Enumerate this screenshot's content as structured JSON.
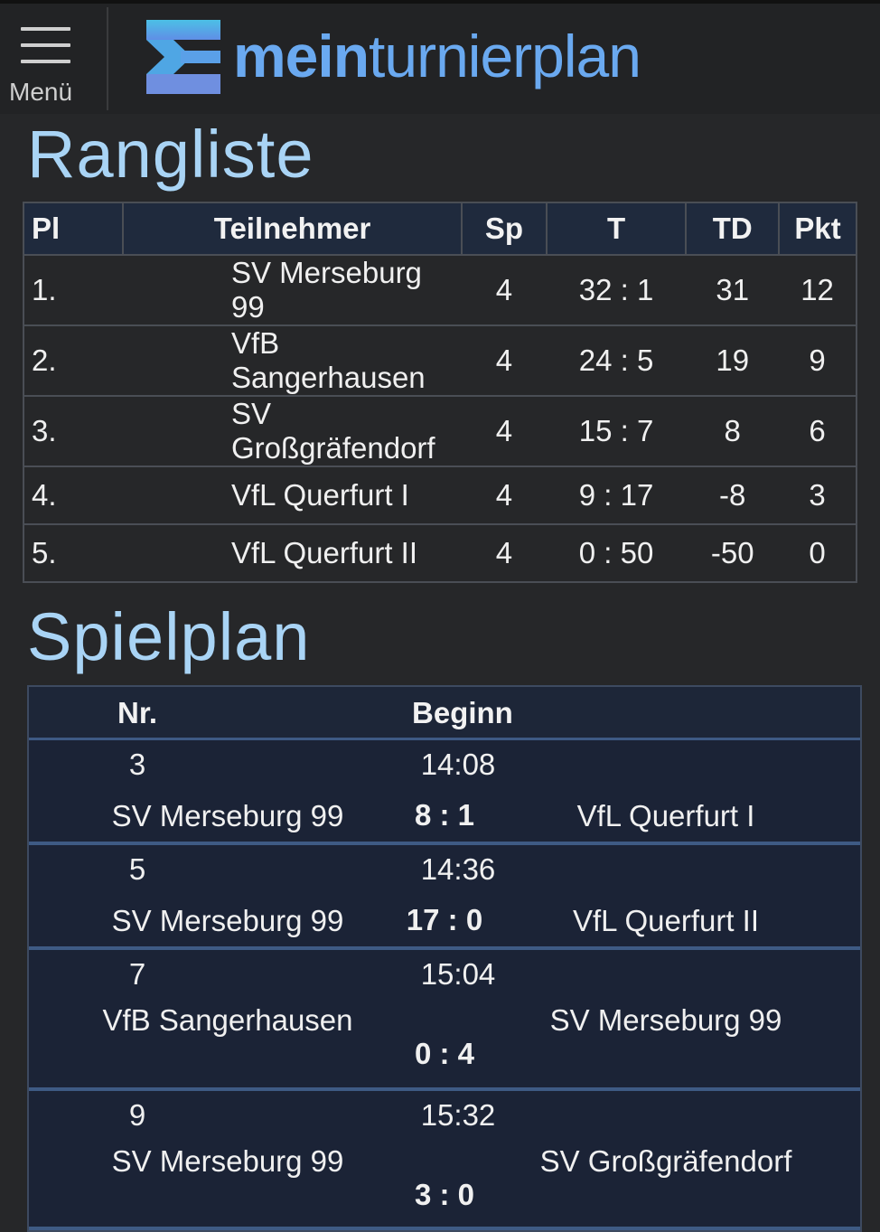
{
  "header": {
    "menu_label": "Menü",
    "logo_bold": "mein",
    "logo_regular": "turnierplan"
  },
  "ranking": {
    "title": "Rangliste",
    "columns": [
      "Pl",
      "Teilnehmer",
      "Sp",
      "T",
      "TD",
      "Pkt"
    ],
    "rows": [
      {
        "pl": "1.",
        "team": "SV Merseburg 99",
        "sp": "4",
        "t": "32 : 1",
        "td": "31",
        "pkt": "12"
      },
      {
        "pl": "2.",
        "team": "VfB Sangerhausen",
        "sp": "4",
        "t": "24 : 5",
        "td": "19",
        "pkt": "9"
      },
      {
        "pl": "3.",
        "team": "SV Großgräfendorf",
        "sp": "4",
        "t": "15 : 7",
        "td": "8",
        "pkt": "6"
      },
      {
        "pl": "4.",
        "team": "VfL Querfurt I",
        "sp": "4",
        "t": "9 : 17",
        "td": "-8",
        "pkt": "3"
      },
      {
        "pl": "5.",
        "team": "VfL Querfurt II",
        "sp": "4",
        "t": "0 : 50",
        "td": "-50",
        "pkt": "0"
      }
    ]
  },
  "schedule": {
    "title": "Spielplan",
    "col_nr": "Nr.",
    "col_begin": "Beginn",
    "matches": [
      {
        "nr": "3",
        "time": "14:08",
        "home": "SV Merseburg 99",
        "score": "8 : 1",
        "away": "VfL Querfurt I"
      },
      {
        "nr": "5",
        "time": "14:36",
        "home": "SV Merseburg 99",
        "score": "17 : 0",
        "away": "VfL Querfurt II"
      },
      {
        "nr": "7",
        "time": "15:04",
        "home": "VfB Sangerhausen",
        "score": "0 : 4",
        "away": "SV Merseburg 99"
      },
      {
        "nr": "9",
        "time": "15:32",
        "home": "SV Merseburg 99",
        "score": "3 : 0",
        "away": "SV Großgräfendorf"
      }
    ]
  },
  "colors": {
    "background": "#262729",
    "accent_blue": "#6aa9f0",
    "heading_blue": "#a9d4f5",
    "table_header": "#1f2a3d"
  }
}
